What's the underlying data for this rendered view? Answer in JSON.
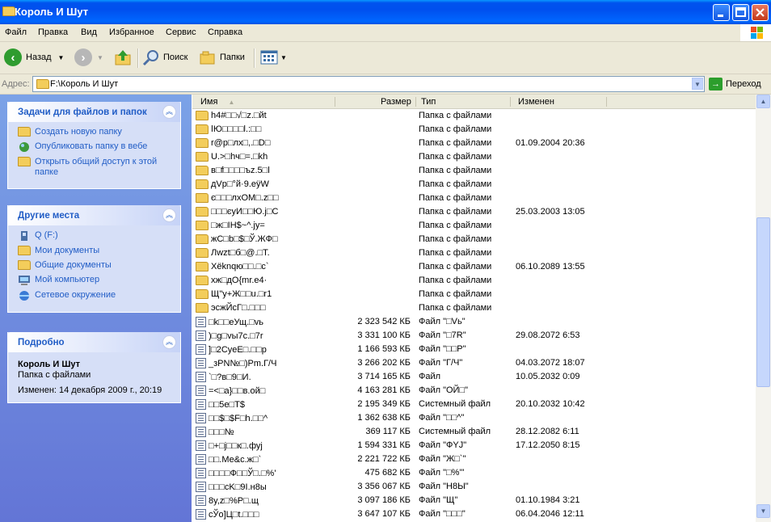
{
  "window": {
    "title": "Король И Шут"
  },
  "menu": [
    "Файл",
    "Правка",
    "Вид",
    "Избранное",
    "Сервис",
    "Справка"
  ],
  "toolbar": {
    "back": "Назад",
    "search": "Поиск",
    "folders": "Папки"
  },
  "address": {
    "label": "Адрес:",
    "path": "F:\\Король И Шут",
    "go": "Переход"
  },
  "tasks": {
    "title": "Задачи для файлов и папок",
    "items": [
      "Создать новую папку",
      "Опубликовать папку в вебе",
      "Открыть общий доступ к этой папке"
    ]
  },
  "places": {
    "title": "Другие места",
    "items": [
      "Q (F:)",
      "Мои документы",
      "Общие документы",
      "Мой компьютер",
      "Сетевое окружение"
    ]
  },
  "details": {
    "title": "Подробно",
    "name": "Король И Шут",
    "kind": "Папка с файлами",
    "modified": "Изменен: 14 декабря 2009 г., 20:19"
  },
  "columns": {
    "name": "Имя",
    "size": "Размер",
    "type": "Тип",
    "date": "Изменен"
  },
  "files": [
    {
      "icon": "folder",
      "name": "h4#□□√□z.□йt",
      "size": "",
      "type": "Папка с файлами",
      "date": ""
    },
    {
      "icon": "folder",
      "name": "ǀЮ□□□□l.:□□",
      "size": "",
      "type": "Папка с файлами",
      "date": ""
    },
    {
      "icon": "folder",
      "name": "r@p□лх□,.□D□",
      "size": "",
      "type": "Папка с файлами",
      "date": "01.09.2004 20:36"
    },
    {
      "icon": "folder",
      "name": "U.>□hч□=.□kh",
      "size": "",
      "type": "Папка с файлами",
      "date": ""
    },
    {
      "icon": "folder",
      "name": "в□f□□□□ъz.5□l",
      "size": "",
      "type": "Папка с файлами",
      "date": ""
    },
    {
      "icon": "folder",
      "name": "дVp□°й·9.eÿW",
      "size": "",
      "type": "Папка с файлами",
      "date": ""
    },
    {
      "icon": "folder",
      "name": "є□□□лхОМ□.z□□",
      "size": "",
      "type": "Папка с файлами",
      "date": ""
    },
    {
      "icon": "folder",
      "name": "□□□єуИ□□Ю.j□C",
      "size": "",
      "type": "Папка с файлами",
      "date": "25.03.2003 13:05"
    },
    {
      "icon": "folder",
      "name": "□ж□IH$~^.jy=",
      "size": "",
      "type": "Папка с файлами",
      "date": ""
    },
    {
      "icon": "folder",
      "name": "жC□b□$□Ў.ЖФ□",
      "size": "",
      "type": "Папка с файлами",
      "date": ""
    },
    {
      "icon": "folder",
      "name": "Лwzt□б□@.□T.",
      "size": "",
      "type": "Папка с файлами",
      "date": ""
    },
    {
      "icon": "folder",
      "name": "Xëknqю□□.□c`",
      "size": "",
      "type": "Папка с файлами",
      "date": "06.10.2089 13:55"
    },
    {
      "icon": "folder",
      "name": "хж□дО{mr.e4·",
      "size": "",
      "type": "Папка с файлами",
      "date": ""
    },
    {
      "icon": "folder",
      "name": "Щ\"у+Ж□□u.□r1",
      "size": "",
      "type": "Папка с файлами",
      "date": ""
    },
    {
      "icon": "folder",
      "name": "эсжЙсГ□.□□□",
      "size": "",
      "type": "Папка с файлами",
      "date": ""
    },
    {
      "icon": "file",
      "name": "□k□□eУщ.□vь",
      "size": "2 323 542 КБ",
      "type": "Файл \"□Vь\"",
      "date": ""
    },
    {
      "icon": "file",
      "name": ")□g□vы7c.□7r",
      "size": "3 331 100 КБ",
      "type": "Файл \"□7R\"",
      "date": "29.08.2072 6:53"
    },
    {
      "icon": "file",
      "name": "]□2CyeE□.□□p",
      "size": "1 166 593 КБ",
      "type": "Файл \"□□P\"",
      "date": ""
    },
    {
      "icon": "file",
      "name": "_зРN№□)Рm.Г/Ч",
      "size": "3 266 202 КБ",
      "type": "Файл \"Г/Ч\"",
      "date": "04.03.2072 18:07"
    },
    {
      "icon": "file",
      "name": "`□?в□9□И.",
      "size": "3 714 165 КБ",
      "type": "Файл",
      "date": "10.05.2032 0:09"
    },
    {
      "icon": "file",
      "name": "=<□a}□□в.ой□",
      "size": "4 163 281 КБ",
      "type": "Файл \"ОЙ□\"",
      "date": ""
    },
    {
      "icon": "file",
      "name": "□□5e□T$",
      "size": "2 195 349 КБ",
      "type": "Системный файл",
      "date": "20.10.2032 10:42"
    },
    {
      "icon": "file",
      "name": "□□$□$F□h.□□^",
      "size": "1 362 638 КБ",
      "type": "Файл \"□□^\"",
      "date": ""
    },
    {
      "icon": "file",
      "name": "□□□№",
      "size": "369 117 КБ",
      "type": "Системный файл",
      "date": "28.12.2082 6:11"
    },
    {
      "icon": "file",
      "name": "□+□j□□к□.фуј",
      "size": "1 594 331 КБ",
      "type": "Файл \"ФYJ\"",
      "date": "17.12.2050 8:15"
    },
    {
      "icon": "file",
      "name": "□□.Ме&c.ж□`",
      "size": "2 221 722 КБ",
      "type": "Файл \"Ж□`\"",
      "date": ""
    },
    {
      "icon": "file",
      "name": "□□□□Ф□□Ў□.□%'",
      "size": "475 682 КБ",
      "type": "Файл \"□%'\"",
      "date": ""
    },
    {
      "icon": "file",
      "name": "□□□cK□9I.н8ы",
      "size": "3 356 067 КБ",
      "type": "Файл \"Н8Ы\"",
      "date": ""
    },
    {
      "icon": "file",
      "name": "8y,z□%Р□.щ",
      "size": "3 097 186 КБ",
      "type": "Файл \"Щ\"",
      "date": "01.10.1984 3:21"
    },
    {
      "icon": "file",
      "name": "сЎо]Ц□t.□□□",
      "size": "3 647 107 КБ",
      "type": "Файл \"□□□\"",
      "date": "06.04.2046 12:11"
    }
  ]
}
